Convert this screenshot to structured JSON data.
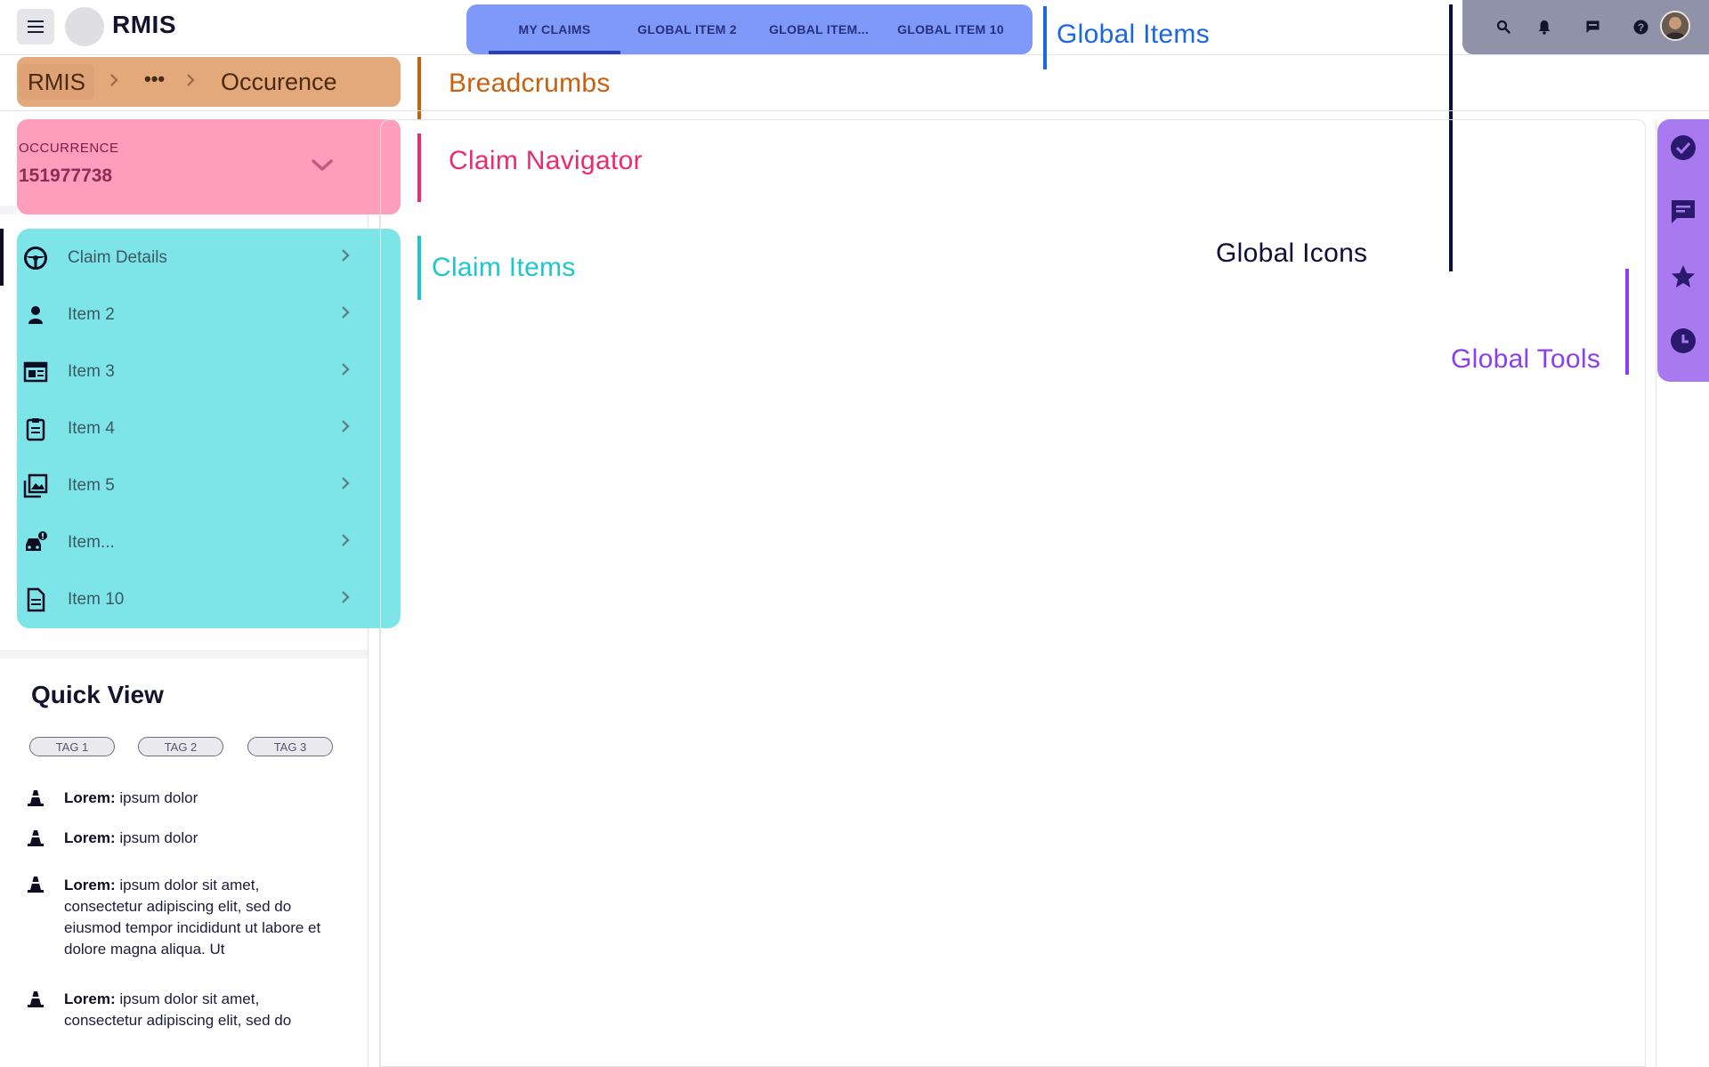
{
  "header": {
    "app_title": "RMIS",
    "menu_icon": "hamburger-icon"
  },
  "global_tabs": [
    {
      "label": "MY CLAIMS",
      "active": true
    },
    {
      "label": "GLOBAL ITEM 2",
      "active": false
    },
    {
      "label": "GLOBAL ITEM...",
      "active": false
    },
    {
      "label": "GLOBAL ITEM 10",
      "active": false
    }
  ],
  "global_icons": [
    "search-icon",
    "bell-icon",
    "feedback-icon",
    "help-icon",
    "avatar"
  ],
  "breadcrumbs": {
    "home": "RMIS",
    "ellipsis": "•••",
    "current": "Occurence"
  },
  "claim_navigator": {
    "label": "OCCURRENCE",
    "value": "151977738"
  },
  "claim_items": [
    {
      "label": "Claim Details",
      "icon": "steering-wheel-icon",
      "active": true
    },
    {
      "label": "Item 2",
      "icon": "person-icon"
    },
    {
      "label": "Item 3",
      "icon": "newspaper-icon"
    },
    {
      "label": "Item 4",
      "icon": "clipboard-icon"
    },
    {
      "label": "Item 5",
      "icon": "photo-library-icon"
    },
    {
      "label": "Item...",
      "icon": "car-alert-icon"
    },
    {
      "label": "Item 10",
      "icon": "document-icon"
    }
  ],
  "quick_view": {
    "title": "Quick View",
    "tags": [
      "TAG 1",
      "TAG 2",
      "TAG 3"
    ],
    "rows": [
      {
        "key": "Lorem:",
        "text": "ipsum dolor"
      },
      {
        "key": "Lorem:",
        "text": "ipsum dolor"
      },
      {
        "key": "Lorem:",
        "text": "ipsum dolor sit amet, consectetur adipiscing elit, sed do eiusmod tempor incididunt ut labore et dolore magna aliqua. Ut"
      },
      {
        "key": "Lorem:",
        "text": "ipsum dolor sit amet, consectetur adipiscing elit, sed do"
      }
    ]
  },
  "global_tools": [
    "check-circle-icon",
    "comment-icon",
    "star-icon",
    "clock-icon"
  ],
  "annotations": {
    "global_items": "Global Items",
    "breadcrumbs": "Breadcrumbs",
    "claim_navigator": "Claim Navigator",
    "claim_items": "Claim Items",
    "global_icons": "Global Icons",
    "global_tools": "Global Tools"
  },
  "colors": {
    "global_items": "#1967e3",
    "breadcrumbs": "#c8600f",
    "claim_navigator": "#ea2c6b",
    "claim_items": "#1fc6cd",
    "global_icons": "#0f0e3a",
    "global_tools": "#8b3df0"
  }
}
